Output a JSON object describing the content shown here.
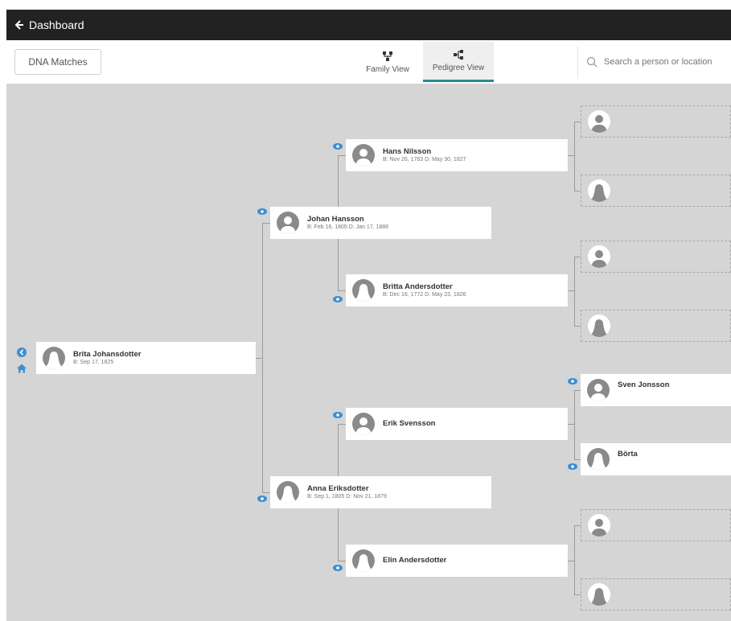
{
  "topbar": {
    "back_label": "Dashboard"
  },
  "toolbar": {
    "dna_button": "DNA Matches",
    "family_view": "Family View",
    "pedigree_view": "Pedigree View",
    "search_placeholder": "Search a person or location"
  },
  "tree": {
    "root": {
      "name": "Brita Johansdotter",
      "dates": "B: Sep 17, 1825"
    },
    "father": {
      "name": "Johan Hansson",
      "dates": "B: Feb 16, 1805 D: Jan 17, 1886"
    },
    "mother": {
      "name": "Anna Eriksdotter",
      "dates": "B: Sep 1, 1805 D: Nov 21, 1879"
    },
    "paternal_grandfather": {
      "name": "Hans Nilsson",
      "dates": "B: Nov 26, 1763 D: May 30, 1827"
    },
    "paternal_grandmother": {
      "name": "Britta Andersdotter",
      "dates": "B: Dec 16, 1772 D: May 23, 1826"
    },
    "maternal_grandfather": {
      "name": "Erik Svensson",
      "dates": ""
    },
    "maternal_grandmother": {
      "name": "Elin Andersdotter",
      "dates": ""
    },
    "ggf_mat": {
      "name": "Sven Jonsson",
      "dates": ""
    },
    "ggm_mat": {
      "name": "Börta",
      "dates": ""
    }
  },
  "colors": {
    "accent": "#2a8c8c",
    "eye": "#3a8fd4",
    "topbar": "#222222",
    "canvas": "#d5d5d5"
  }
}
